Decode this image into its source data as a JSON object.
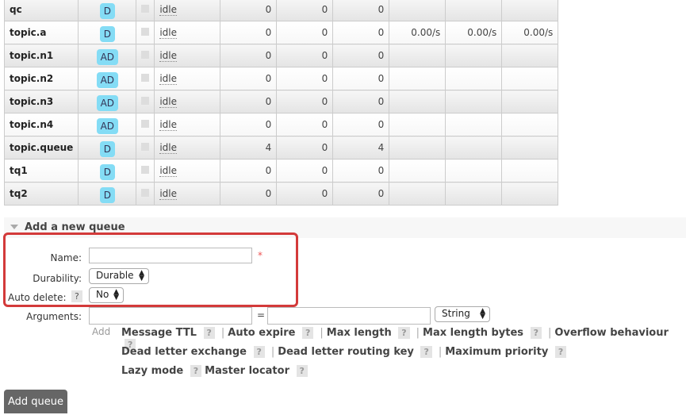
{
  "queues": [
    {
      "name": "qc",
      "features": "D",
      "state": "idle",
      "ready": "0",
      "unacked": "0",
      "total": "0",
      "incoming": "",
      "deliver": "",
      "ack": ""
    },
    {
      "name": "topic.a",
      "features": "D",
      "state": "idle",
      "ready": "0",
      "unacked": "0",
      "total": "0",
      "incoming": "0.00/s",
      "deliver": "0.00/s",
      "ack": "0.00/s"
    },
    {
      "name": "topic.n1",
      "features": "AD",
      "state": "idle",
      "ready": "0",
      "unacked": "0",
      "total": "0",
      "incoming": "",
      "deliver": "",
      "ack": ""
    },
    {
      "name": "topic.n2",
      "features": "AD",
      "state": "idle",
      "ready": "0",
      "unacked": "0",
      "total": "0",
      "incoming": "",
      "deliver": "",
      "ack": ""
    },
    {
      "name": "topic.n3",
      "features": "AD",
      "state": "idle",
      "ready": "0",
      "unacked": "0",
      "total": "0",
      "incoming": "",
      "deliver": "",
      "ack": ""
    },
    {
      "name": "topic.n4",
      "features": "AD",
      "state": "idle",
      "ready": "0",
      "unacked": "0",
      "total": "0",
      "incoming": "",
      "deliver": "",
      "ack": ""
    },
    {
      "name": "topic.queue",
      "features": "D",
      "state": "idle",
      "ready": "4",
      "unacked": "0",
      "total": "4",
      "incoming": "",
      "deliver": "",
      "ack": ""
    },
    {
      "name": "tq1",
      "features": "D",
      "state": "idle",
      "ready": "0",
      "unacked": "0",
      "total": "0",
      "incoming": "",
      "deliver": "",
      "ack": ""
    },
    {
      "name": "tq2",
      "features": "D",
      "state": "idle",
      "ready": "0",
      "unacked": "0",
      "total": "0",
      "incoming": "",
      "deliver": "",
      "ack": ""
    }
  ],
  "add_queue": {
    "section_title": "Add a new queue",
    "name_label": "Name:",
    "name_value": "",
    "required_mark": "*",
    "durability_label": "Durability:",
    "durability_value": "Durable",
    "auto_delete_label": "Auto delete:",
    "help": "?",
    "auto_delete_value": "No",
    "arguments_label": "Arguments:",
    "equals": "=",
    "arg_type_value": "String",
    "add_label": "Add",
    "arg_rows": [
      [
        "Message TTL",
        "Auto expire",
        "Max length",
        "Max length bytes",
        "Overflow behaviour"
      ],
      [
        "Dead letter exchange",
        "Dead letter routing key",
        "Maximum priority"
      ],
      [
        "Lazy mode",
        "Master locator"
      ]
    ],
    "submit_label": "Add queue"
  }
}
